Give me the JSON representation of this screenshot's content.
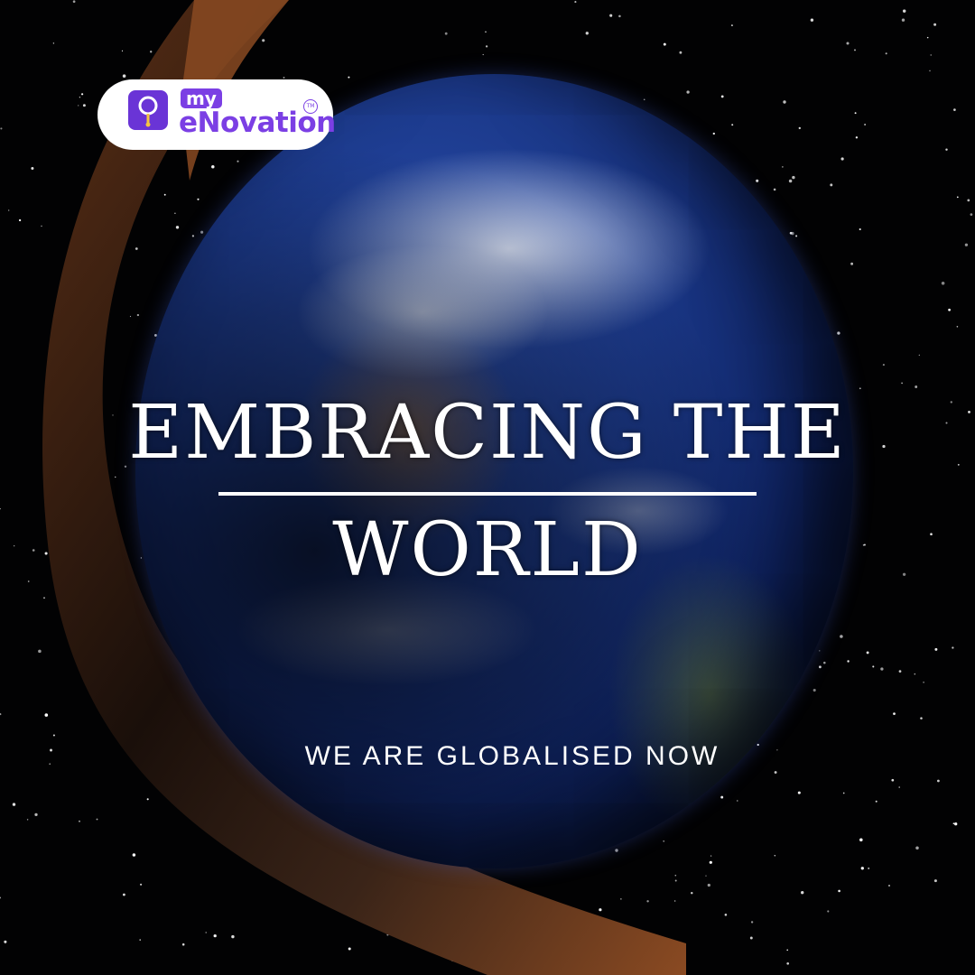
{
  "logo": {
    "prefix": "my",
    "name": "eNovation",
    "trademark": "TM",
    "brand_color": "#7b3fe4",
    "icon": "lightbulb-pen-icon"
  },
  "headline": {
    "line1": "EMBRACING THE",
    "line2": "WORLD"
  },
  "tagline": "WE ARE GLOBALISED NOW",
  "colors": {
    "background": "#020203",
    "accent_swoosh": "#7a4220",
    "text": "#ffffff"
  },
  "imagery": {
    "globe": "earth-globe",
    "backdrop": "starfield"
  }
}
